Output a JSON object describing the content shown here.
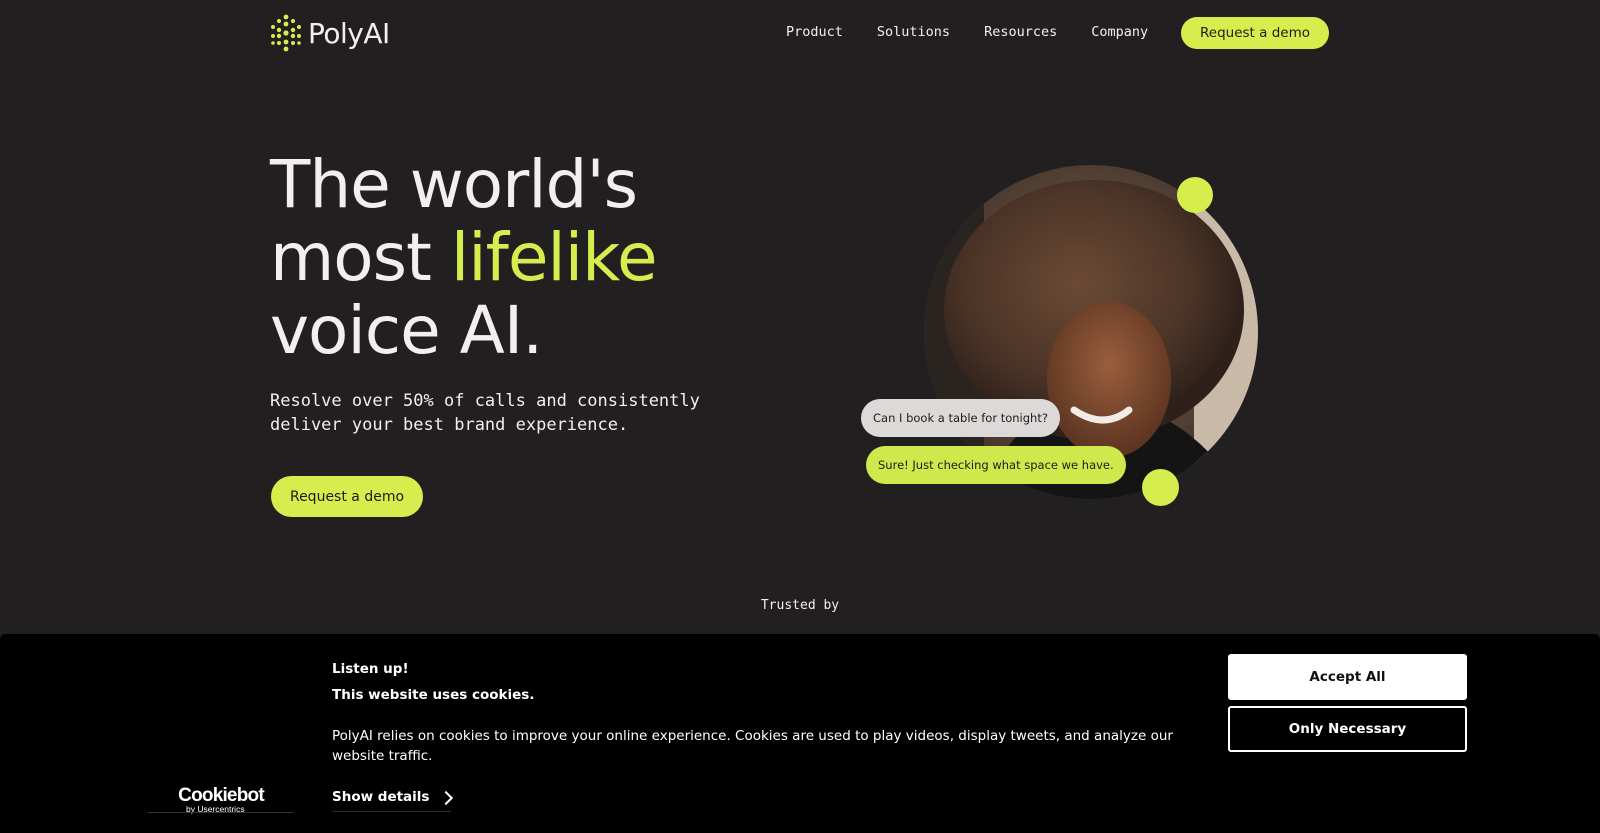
{
  "brand": {
    "name": "PolyAI",
    "accent": "#d5ee4e"
  },
  "nav": {
    "items": [
      "Product",
      "Solutions",
      "Resources",
      "Company"
    ],
    "cta": "Request a demo"
  },
  "hero": {
    "title_line1": "The world's",
    "title_line2_pre": "most ",
    "title_line2_accent": "lifelike",
    "title_line3": "voice AI.",
    "subtitle": "Resolve over 50% of calls and consistently deliver your best brand experience.",
    "cta": "Request a demo"
  },
  "chat": {
    "user_message": "Can I book a table for tonight?",
    "ai_message": "Sure! Just checking what space we have."
  },
  "trusted": {
    "label": "Trusted by"
  },
  "cookie_banner": {
    "logo_main": "Cookiebot",
    "logo_sub": "by Usercentrics",
    "heading": "Listen up!",
    "subheading": "This website uses cookies.",
    "body": "PolyAI relies on cookies to improve your online experience. Cookies are used to play videos, display tweets, and analyze our website traffic.",
    "show_details": "Show details",
    "accept_all": "Accept All",
    "only_necessary": "Only Necessary"
  }
}
